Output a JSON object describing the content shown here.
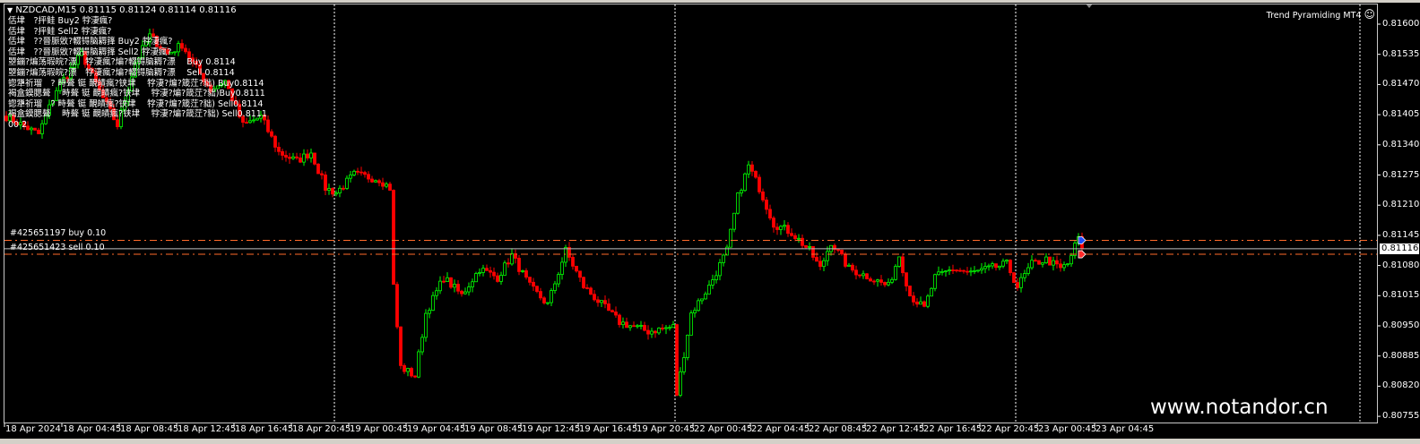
{
  "window": {
    "title": "NZDCAD,M15  0.81115 0.81124 0.81114 0.81116",
    "ea_name": "Trend Pyramiding MT4",
    "ea_icon": "smiley-face-icon",
    "watermark": "www.notandor.cn"
  },
  "info_lines": [
    "佸垏　?抨鲑 Buy2 牸淒瘋?",
    "佸垏　?抨鲑 Sell2 牸淒瘋?",
    "佸垏　??晉脤敓?輟锝脑耨箨 Buy2 牸淒瘋?",
    "佸垏　??晉脤敓?輟锝脑耨箨 Sell2 牸淒瘋?",
    "曌鏰?煸荡瑕皖?漂　牸淒瘋?煸?輟锝脑耨?漂　 Buy 0.8114",
    "曌鏰?煸荡瑕皖?漂　牸淒瘋?煸?輟锝脑耨?漂　 Sell 0.8114",
    "锪犟祈瑠　? 畤聱 铤 靦皟瘋?铗垏　 牸淒?煸?箴茳?貀) Buy0.8114",
    "褐盒鏌腮聱　 畤聱 铤 靦皟瘋?铗垏　 牸淒?煸?箴茳?貀)Buy0.8111",
    "锪犟祈瑠　? 畤聱 铤 靦皟瘋?铗垏　 牸淒?煸?箴茳?貀) Sell0.8114",
    "褐盒鏌腮聱　 畤聱 铤 靦皟瘋?铗垏　 牸淒?煸?箴茳?貀) Sell0.8111",
    "00 2"
  ],
  "orders": [
    {
      "label": "#425651197 buy 0.10",
      "price": 0.8114,
      "color": "#ff6a2a",
      "arrow_color": "#1e4bff"
    },
    {
      "label": "#425651423 sell 0.10",
      "price": 0.8111,
      "color": "#ff6a2a",
      "arrow_color": "#ff2a2a"
    }
  ],
  "current_price": {
    "label": "0.81116",
    "value": 0.81116,
    "line_color": "#c0c0c0"
  },
  "colors": {
    "bull": "#00ff00",
    "bear": "#ff0000",
    "background": "#000000",
    "grid": "#ffffff"
  },
  "chart_data": {
    "type": "candlestick",
    "symbol": "NZDCAD",
    "timeframe": "M15",
    "ylim": [
      0.80755,
      0.816
    ],
    "y_ticks": [
      "0.81600",
      "0.81535",
      "0.81470",
      "0.81405",
      "0.81340",
      "0.81275",
      "0.81210",
      "0.81145",
      "0.81080",
      "0.81015",
      "0.80950",
      "0.80885",
      "0.80820",
      "0.80755"
    ],
    "x_ticks": [
      "18 Apr 2024",
      "18 Apr 04:45",
      "18 Apr 08:45",
      "18 Apr 12:45",
      "18 Apr 16:45",
      "18 Apr 20:45",
      "19 Apr 00:45",
      "19 Apr 04:45",
      "19 Apr 08:45",
      "19 Apr 12:45",
      "19 Apr 16:45",
      "19 Apr 20:45",
      "22 Apr 00:45",
      "22 Apr 04:45",
      "22 Apr 08:45",
      "22 Apr 12:45",
      "22 Apr 16:45",
      "22 Apr 20:45",
      "23 Apr 00:45",
      "23 Apr 04:45"
    ],
    "day_separators_bar_index": [
      92,
      187,
      282
    ],
    "price_path": {
      "bar_index": [
        0,
        9,
        14,
        21,
        27,
        31,
        36,
        40,
        45,
        49,
        52,
        57,
        61,
        66,
        71,
        76,
        81,
        85,
        89,
        92,
        97,
        104,
        107,
        108,
        110,
        114,
        117,
        122,
        127,
        132,
        137,
        141,
        146,
        151,
        156,
        161,
        166,
        171,
        179,
        186,
        187,
        191,
        196,
        201,
        204,
        207,
        210,
        214,
        219,
        224,
        227,
        230,
        235,
        241,
        246,
        249,
        252,
        256,
        259,
        264,
        269,
        274,
        279,
        282,
        286,
        290,
        294,
        296,
        299,
        300
      ],
      "price": [
        0.81401,
        0.81363,
        0.81459,
        0.81536,
        0.8144,
        0.81382,
        0.81517,
        0.81575,
        0.81536,
        0.81556,
        0.81517,
        0.81459,
        0.81478,
        0.81382,
        0.81401,
        0.81324,
        0.81305,
        0.81324,
        0.81247,
        0.81237,
        0.81276,
        0.81266,
        0.81247,
        0.81035,
        0.80861,
        0.80842,
        0.80977,
        0.81054,
        0.81016,
        0.81073,
        0.81054,
        0.81102,
        0.81035,
        0.80996,
        0.81112,
        0.81035,
        0.80996,
        0.80958,
        0.80938,
        0.80948,
        0.80803,
        0.80977,
        0.81035,
        0.81112,
        0.81228,
        0.81295,
        0.81247,
        0.8117,
        0.81151,
        0.81112,
        0.81073,
        0.81131,
        0.81073,
        0.81054,
        0.81035,
        0.81102,
        0.81016,
        0.80987,
        0.81054,
        0.81073,
        0.81064,
        0.81073,
        0.81083,
        0.81035,
        0.81083,
        0.81093,
        0.81073,
        0.81083,
        0.81141,
        0.81116
      ]
    },
    "last_bar": {
      "open": 0.81115,
      "high": 0.81124,
      "low": 0.81114,
      "close": 0.81116
    }
  }
}
